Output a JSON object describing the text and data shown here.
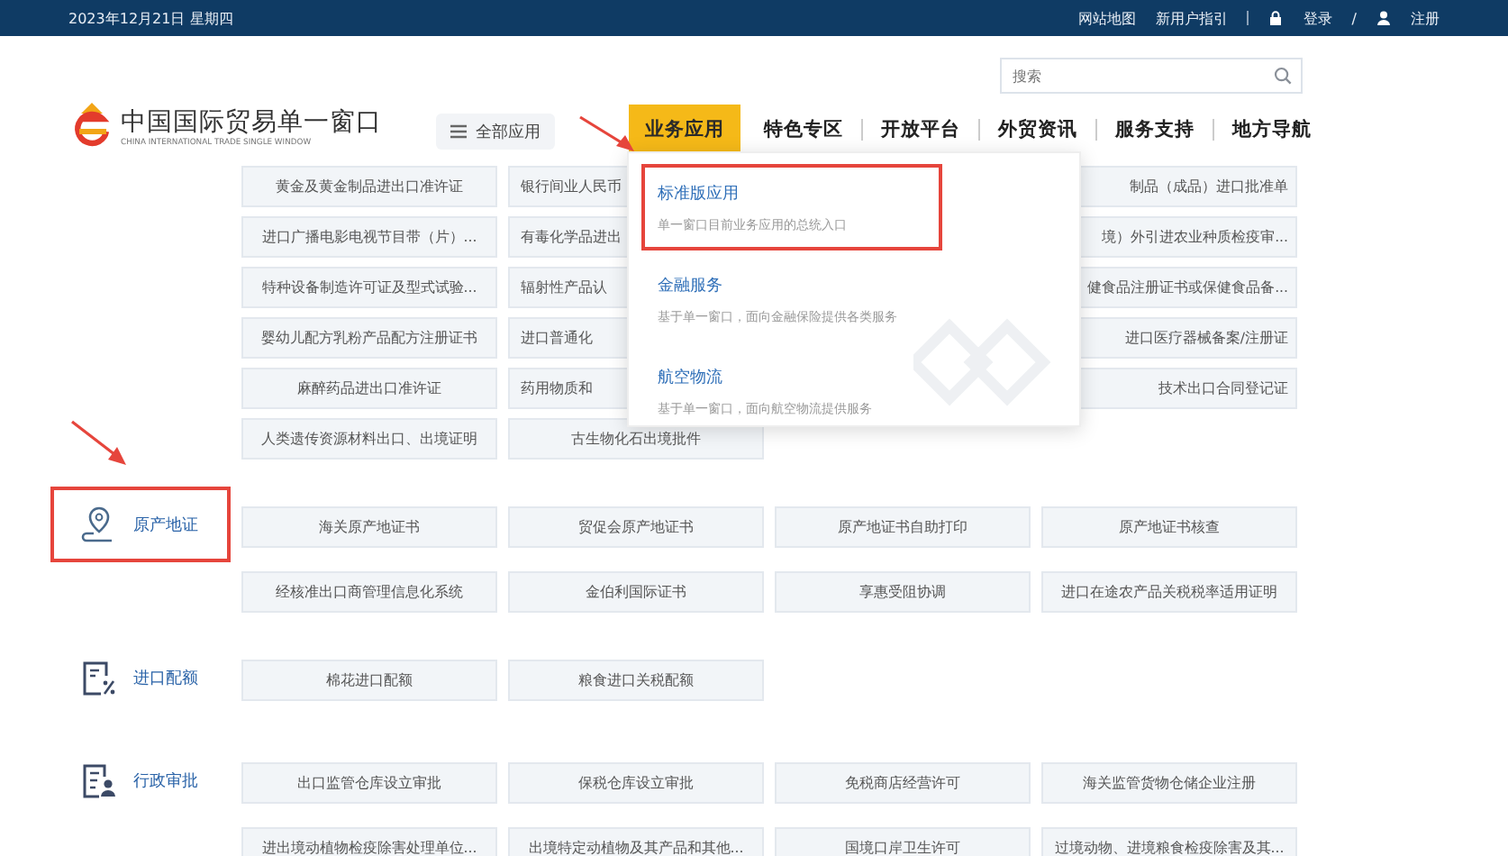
{
  "top_bar": {
    "date": "2023年12月21日 星期四",
    "links": [
      "网站地图",
      "新用户指引"
    ],
    "login": "登录",
    "separator": "/",
    "register": "注册"
  },
  "header": {
    "logo_title": "中国国际贸易单一窗口",
    "logo_subtitle": "CHINA INTERNATIONAL TRADE SINGLE WINDOW",
    "search": {
      "placeholder": "搜索"
    },
    "all_apps": "全部应用",
    "nav": [
      {
        "label": "业务应用",
        "selected": true
      },
      {
        "label": "特色专区",
        "selected": false
      },
      {
        "label": "开放平台",
        "selected": false
      },
      {
        "label": "外贸资讯",
        "selected": false
      },
      {
        "label": "服务支持",
        "selected": false
      },
      {
        "label": "地方导航",
        "selected": false
      }
    ]
  },
  "dropdown": {
    "items": [
      {
        "title": "标准版应用",
        "desc": "单一窗口目前业务应用的总统入口",
        "highlighted": true
      },
      {
        "title": "金融服务",
        "desc": "基于单一窗口，面向金融保险提供各类服务",
        "highlighted": false
      },
      {
        "title": "航空物流",
        "desc": "基于单一窗口，面向航空物流提供服务",
        "highlighted": false
      }
    ]
  },
  "top_grid": {
    "rows": [
      {
        "cells": [
          "黄金及黄金制品进出口准许证",
          "银行间业人民币",
          "制品（成品）进口批准单"
        ]
      },
      {
        "cells": [
          "进口广播电影电视节目带（片）...",
          "有毒化学品进出",
          "境）外引进农业种质检疫审..."
        ]
      },
      {
        "cells": [
          "特种设备制造许可证及型式试验...",
          "辐射性产品认",
          "健食品注册证书或保健食品备..."
        ]
      },
      {
        "cells": [
          "婴幼儿配方乳粉产品配方注册证书",
          "进口普通化",
          "进口医疗器械备案/注册证"
        ]
      },
      {
        "cells": [
          "麻醉药品进出口准许证",
          "药用物质和",
          "技术出口合同登记证"
        ]
      },
      {
        "cells": [
          "人类遗传资源材料出口、出境证明",
          "古生物化石出境批件"
        ]
      }
    ]
  },
  "sections": [
    {
      "title": "原产地证",
      "highlighted": true,
      "items": [
        "海关原产地证书",
        "贸促会原产地证书",
        "原产地证书自助打印",
        "原产地证书核查",
        "经核准出口商管理信息化系统",
        "金伯利国际证书",
        "享惠受阻协调",
        "进口在途农产品关税税率适用证明"
      ]
    },
    {
      "title": "进口配额",
      "highlighted": false,
      "items": [
        "棉花进口配额",
        "粮食进口关税配额"
      ]
    },
    {
      "title": "行政审批",
      "highlighted": false,
      "items": [
        "出口监管仓库设立审批",
        "保税仓库设立审批",
        "免税商店经营许可",
        "海关监管货物仓储企业注册",
        "进出境动植物检疫除害处理单位...",
        "出境特定动植物及其产品和其他...",
        "国境口岸卫生许可",
        "过境动物、进境粮食检疫除害及其..."
      ]
    }
  ]
}
